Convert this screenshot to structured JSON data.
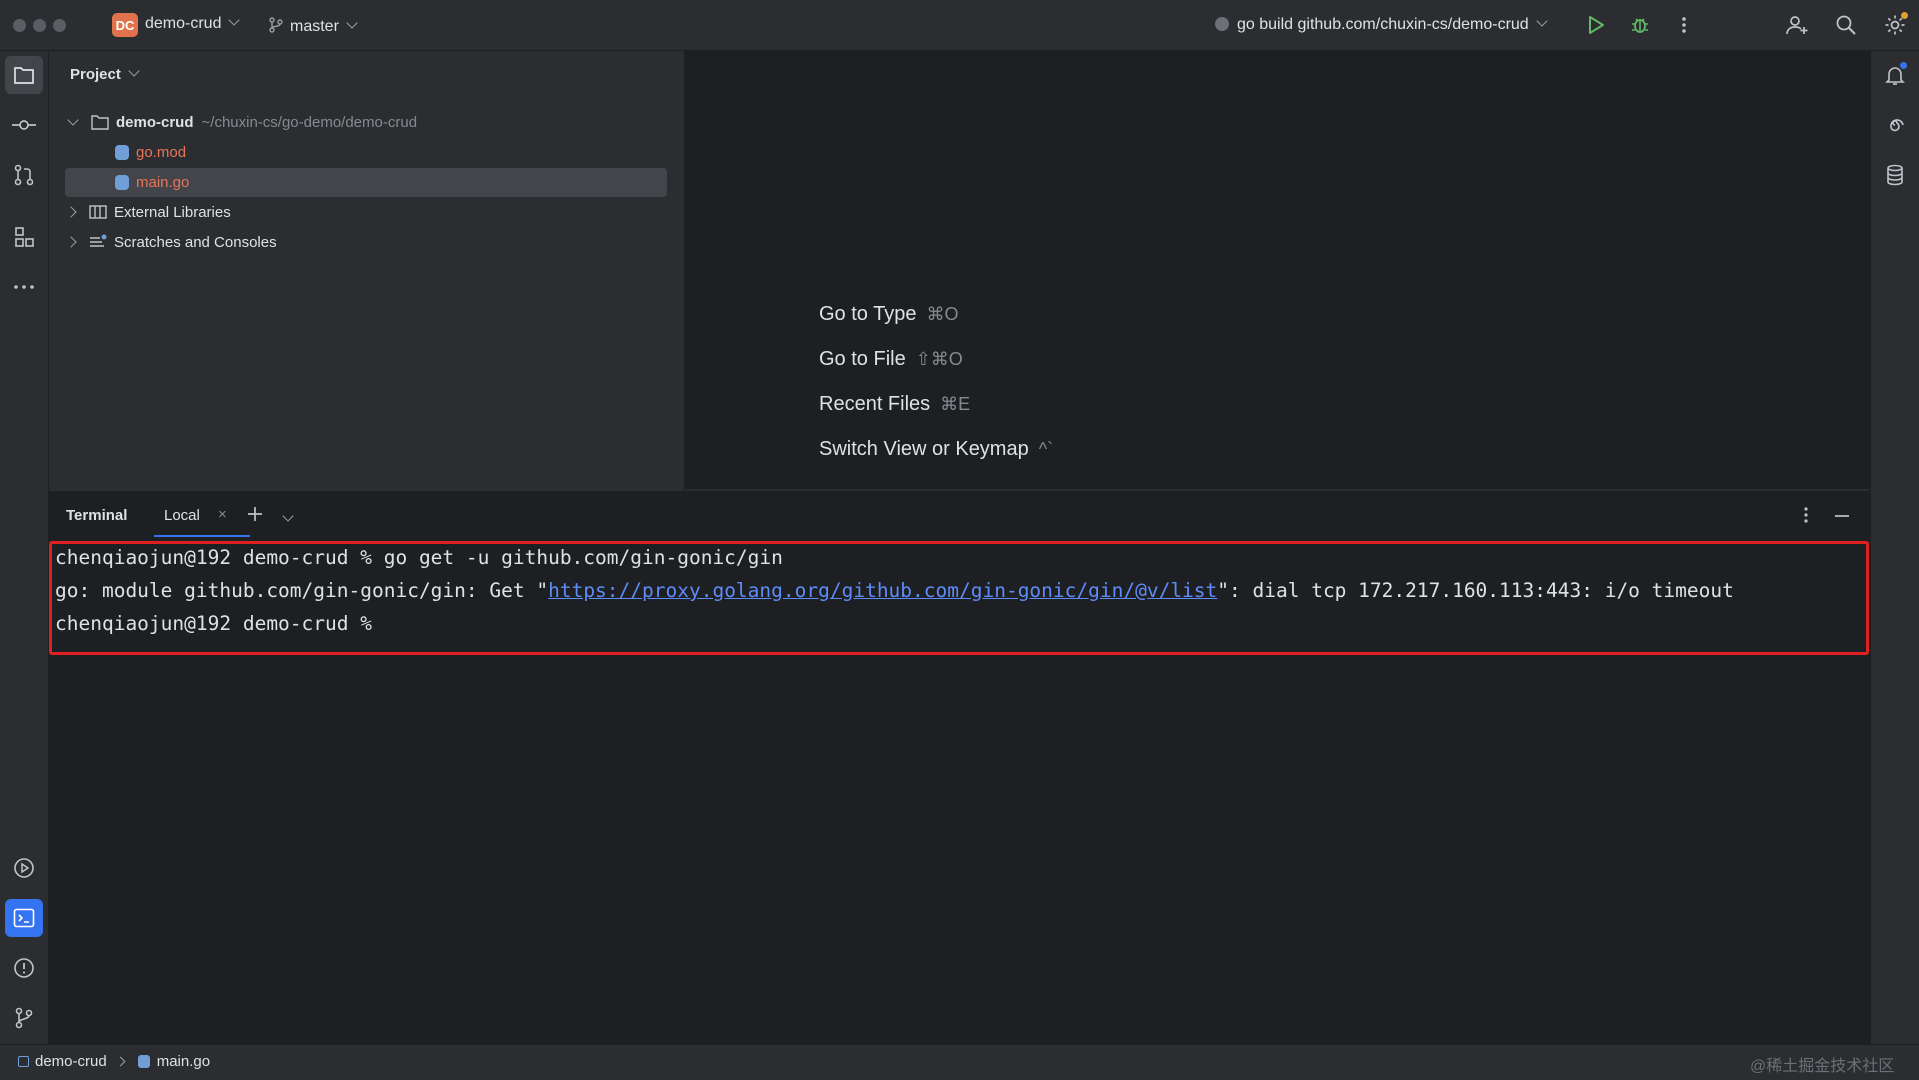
{
  "titlebar": {
    "project_badge": "DC",
    "project_name": "demo-crud",
    "branch": "master",
    "run_config": "go build github.com/chuxin-cs/demo-crud"
  },
  "project_panel": {
    "title": "Project",
    "tree": [
      {
        "label": "demo-crud",
        "path": "~/chuxin-cs/go-demo/demo-crud"
      },
      {
        "label": "go.mod"
      },
      {
        "label": "main.go"
      },
      {
        "label": "External Libraries"
      },
      {
        "label": "Scratches and Consoles"
      }
    ]
  },
  "editor_hints": [
    {
      "label": "Go to Type",
      "shortcut": "⌘O"
    },
    {
      "label": "Go to File",
      "shortcut": "⇧⌘O"
    },
    {
      "label": "Recent Files",
      "shortcut": "⌘E"
    },
    {
      "label": "Switch View or Keymap",
      "shortcut": "^`"
    }
  ],
  "terminal": {
    "title": "Terminal",
    "tab": "Local",
    "lines": {
      "l1": "chenqiaojun@192 demo-crud % go get -u github.com/gin-gonic/gin",
      "l2_prefix": "go: module github.com/gin-gonic/gin: Get \"",
      "l2_link": "https://proxy.golang.org/github.com/gin-gonic/gin/@v/list",
      "l2_suffix": "\": dial tcp 172.217.160.113:443: i/o timeout",
      "l3": "chenqiaojun@192 demo-crud %"
    }
  },
  "statusbar": {
    "crumb_project": "demo-crud",
    "crumb_file": "main.go",
    "watermark": "@稀土掘金技术社区"
  },
  "colors": {
    "accent": "#3574f0",
    "run_green": "#5fb865",
    "highlight_red": "#e02020",
    "link_blue": "#5e8cf7",
    "file_orange": "#e8755a"
  }
}
